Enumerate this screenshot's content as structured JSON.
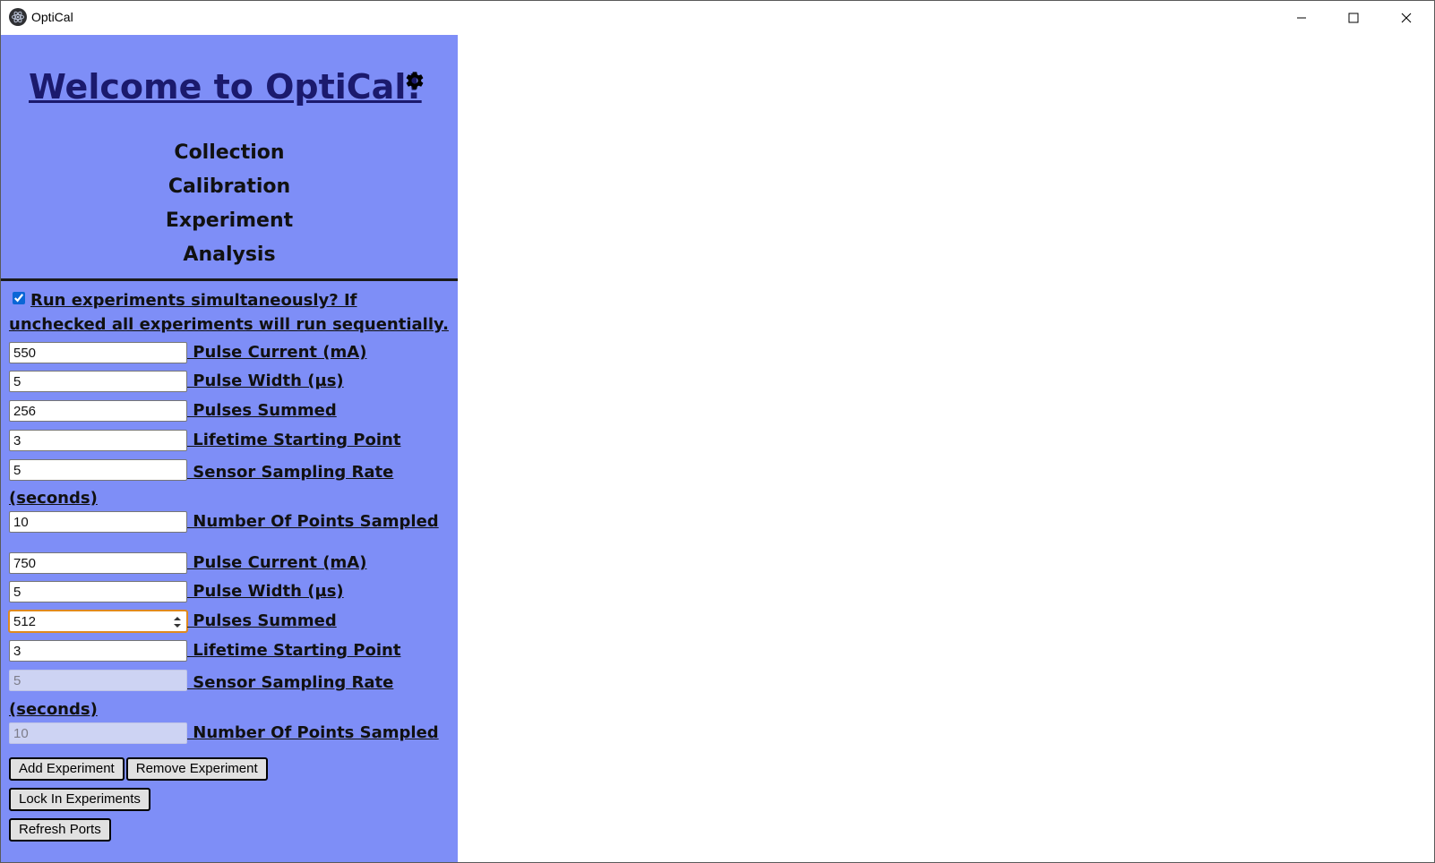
{
  "window": {
    "title": "OptiCal",
    "controls": [
      "minimize-icon",
      "maximize-icon",
      "close-icon"
    ]
  },
  "sidebar": {
    "welcome": "Welcome to OptiCal!",
    "settings_icon": "gear-icon",
    "nav": [
      {
        "label": "Collection"
      },
      {
        "label": "Calibration"
      },
      {
        "label": "Experiment"
      },
      {
        "label": "Analysis"
      }
    ],
    "simultaneous": {
      "checked": true,
      "label": "Run experiments simultaneously? If unchecked all experiments will run sequentially."
    },
    "experiments": [
      {
        "fields": [
          {
            "value": "550",
            "label": " Pulse Current (mA)",
            "disabled": false
          },
          {
            "value": "5",
            "label": " Pulse Width (µs)",
            "disabled": false
          },
          {
            "value": "256",
            "label": " Pulses Summed",
            "disabled": false
          },
          {
            "value": "3",
            "label": " Lifetime Starting Point",
            "disabled": false
          },
          {
            "value": "5",
            "label": " Sensor Sampling Rate (seconds)",
            "disabled": false
          },
          {
            "value": "10",
            "label": " Number Of Points Sampled",
            "disabled": false
          }
        ]
      },
      {
        "fields": [
          {
            "value": "750",
            "label": " Pulse Current (mA)",
            "disabled": false
          },
          {
            "value": "5",
            "label": " Pulse Width (µs)",
            "disabled": false
          },
          {
            "value": "512",
            "label": " Pulses Summed",
            "disabled": false,
            "focused": true
          },
          {
            "value": "3",
            "label": " Lifetime Starting Point",
            "disabled": false
          },
          {
            "value": "5",
            "label": " Sensor Sampling Rate (seconds)",
            "disabled": true
          },
          {
            "value": "10",
            "label": " Number Of Points Sampled",
            "disabled": true
          }
        ]
      }
    ],
    "buttons": {
      "add": "Add Experiment",
      "remove": "Remove Experiment",
      "lock": "Lock In Experiments",
      "refresh": "Refresh Ports"
    }
  },
  "colors": {
    "sidebar_bg": "#7e8ef7",
    "welcome_link": "#1b1a6d",
    "disabled_input_bg": "#cdd3f3",
    "focus_outline": "#e08a1e"
  }
}
